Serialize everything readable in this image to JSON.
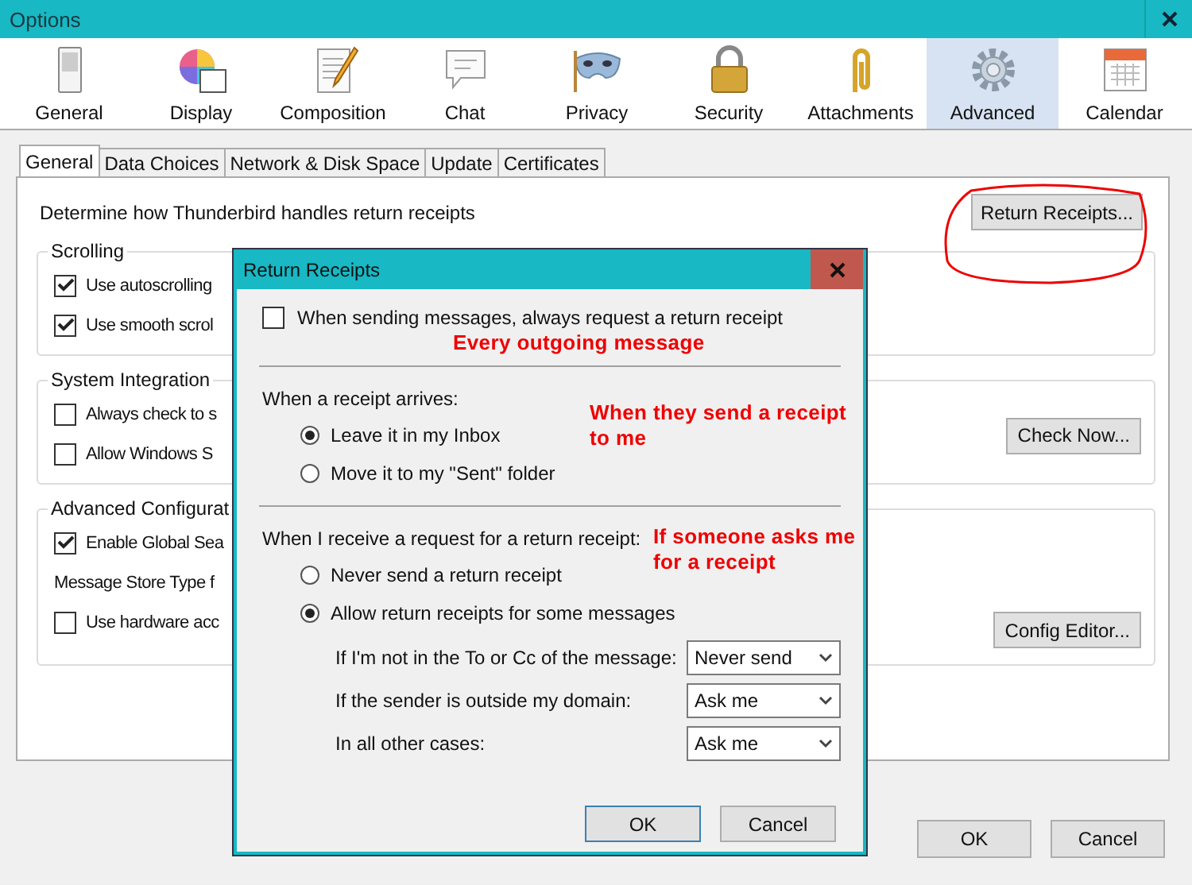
{
  "window": {
    "title": "Options"
  },
  "toolbar": [
    {
      "label": "General",
      "selected": false
    },
    {
      "label": "Display",
      "selected": false
    },
    {
      "label": "Composition",
      "selected": false
    },
    {
      "label": "Chat",
      "selected": false
    },
    {
      "label": "Privacy",
      "selected": false
    },
    {
      "label": "Security",
      "selected": false
    },
    {
      "label": "Attachments",
      "selected": false
    },
    {
      "label": "Advanced",
      "selected": true
    },
    {
      "label": "Calendar",
      "selected": false
    }
  ],
  "tabs": [
    {
      "label": "General",
      "selected": true
    },
    {
      "label": "Data Choices",
      "selected": false
    },
    {
      "label": "Network & Disk Space",
      "selected": false
    },
    {
      "label": "Update",
      "selected": false
    },
    {
      "label": "Certificates",
      "selected": false
    }
  ],
  "general": {
    "receipts_text": "Determine how Thunderbird handles return receipts",
    "receipts_button": "Return Receipts...",
    "groups": [
      {
        "title": "Scrolling",
        "items": [
          {
            "kind": "checkbox",
            "label": "Use autoscrolling",
            "checked": true
          },
          {
            "kind": "checkbox",
            "label": "Use smooth scrol",
            "checked": true
          }
        ]
      },
      {
        "title": "System Integration",
        "button": "Check Now...",
        "items": [
          {
            "kind": "checkbox",
            "label": "Always check to s",
            "checked": false
          },
          {
            "kind": "checkbox",
            "label": "Allow Windows S",
            "checked": false
          }
        ]
      },
      {
        "title": "Advanced Configurat",
        "button": "Config Editor...",
        "items": [
          {
            "kind": "checkbox",
            "label": "Enable Global Sea",
            "checked": true
          },
          {
            "kind": "text",
            "label": "Message Store Type f"
          },
          {
            "kind": "checkbox",
            "label": "Use hardware acc",
            "checked": false
          }
        ]
      }
    ]
  },
  "dialog": {
    "title": "Return Receipts",
    "always_request": {
      "label": "When sending messages, always request a return receipt",
      "checked": false
    },
    "arrives": {
      "heading": "When a receipt arrives:",
      "options": [
        {
          "label": "Leave it in my Inbox",
          "selected": true
        },
        {
          "label": "Move it to my \"Sent\" folder",
          "selected": false
        }
      ]
    },
    "request": {
      "heading": "When I receive a request for a return receipt:",
      "options": [
        {
          "label": "Never send a return receipt",
          "selected": false
        },
        {
          "label": "Allow return receipts for some messages",
          "selected": true
        }
      ]
    },
    "rules": [
      {
        "label": "If I'm not in the To or Cc of the message:",
        "value": "Never send"
      },
      {
        "label": "If the sender is outside my domain:",
        "value": "Ask me"
      },
      {
        "label": "In all other cases:",
        "value": "Ask me"
      }
    ],
    "buttons": [
      "OK",
      "Cancel"
    ]
  },
  "annotations": [
    "Every outgoing message",
    "When they send a receipt to me",
    "If someone asks me for a receipt"
  ],
  "buttons": [
    "OK",
    "Cancel"
  ]
}
